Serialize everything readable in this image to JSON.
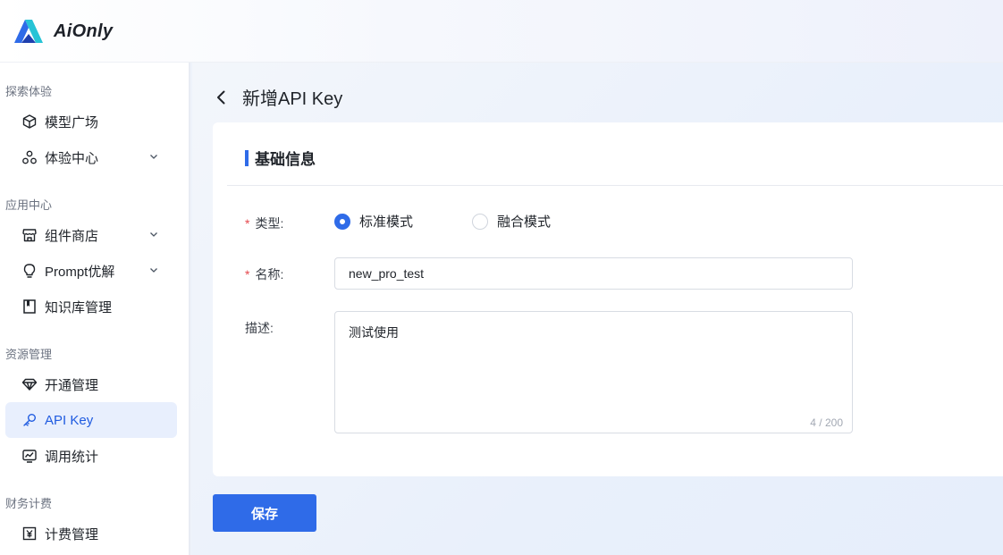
{
  "brand": {
    "name": "AiOnly",
    "color": "#2f6be8"
  },
  "sidebar": {
    "groups": [
      {
        "title": "探索体验",
        "items": [
          {
            "label": "模型广场",
            "icon": "cube-icon",
            "has_chevron": false
          },
          {
            "label": "体验中心",
            "icon": "molecule-icon",
            "has_chevron": true
          }
        ]
      },
      {
        "title": "应用中心",
        "items": [
          {
            "label": "组件商店",
            "icon": "store-icon",
            "has_chevron": true
          },
          {
            "label": "Prompt优解",
            "icon": "bulb-icon",
            "has_chevron": true
          },
          {
            "label": "知识库管理",
            "icon": "book-icon",
            "has_chevron": false
          }
        ]
      },
      {
        "title": "资源管理",
        "items": [
          {
            "label": "开通管理",
            "icon": "diamond-icon",
            "has_chevron": false
          },
          {
            "label": "API Key",
            "icon": "key-icon",
            "has_chevron": false,
            "active": true
          },
          {
            "label": "调用统计",
            "icon": "chart-icon",
            "has_chevron": false
          }
        ]
      },
      {
        "title": "财务计费",
        "items": [
          {
            "label": "计费管理",
            "icon": "yen-icon",
            "has_chevron": false
          }
        ]
      }
    ]
  },
  "page": {
    "title": "新增API Key"
  },
  "form": {
    "section_title": "基础信息",
    "type": {
      "label": "类型:",
      "required": true,
      "options": [
        "标准模式",
        "融合模式"
      ],
      "selected": "标准模式"
    },
    "name": {
      "label": "名称:",
      "required": true,
      "value": "new_pro_test"
    },
    "description": {
      "label": "描述:",
      "value": "测试使用",
      "counter": "4 / 200"
    },
    "save_label": "保存"
  }
}
